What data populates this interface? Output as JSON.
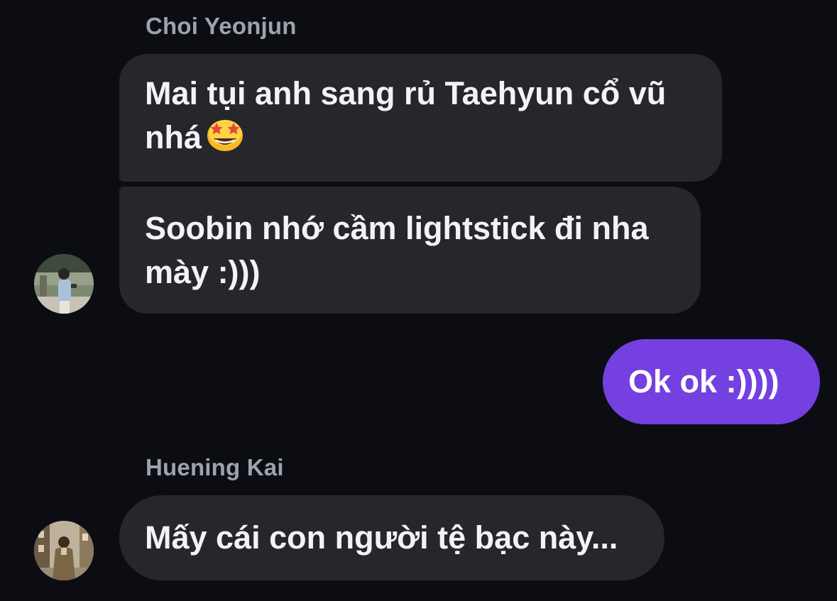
{
  "conversation": {
    "group1": {
      "sender": "Choi Yeonjun",
      "messages": [
        {
          "text": "Mai tụi anh sang rủ Taehyun cổ vũ\nnhá",
          "emoji": "star-struck-emoji"
        },
        {
          "text": "Soobin nhớ cầm lightstick đi nha\nmày :)))"
        }
      ]
    },
    "outgoing": {
      "text": "Ok ok :))))"
    },
    "group2": {
      "sender": "Huening Kai",
      "messages": [
        {
          "text": "Mấy cái con người tệ bạc này..."
        }
      ]
    }
  },
  "colors": {
    "background": "#0b0d12",
    "incoming_bubble": "#25272c",
    "outgoing_bubble": "#7440e0",
    "sender_name": "#9ea2ab"
  }
}
